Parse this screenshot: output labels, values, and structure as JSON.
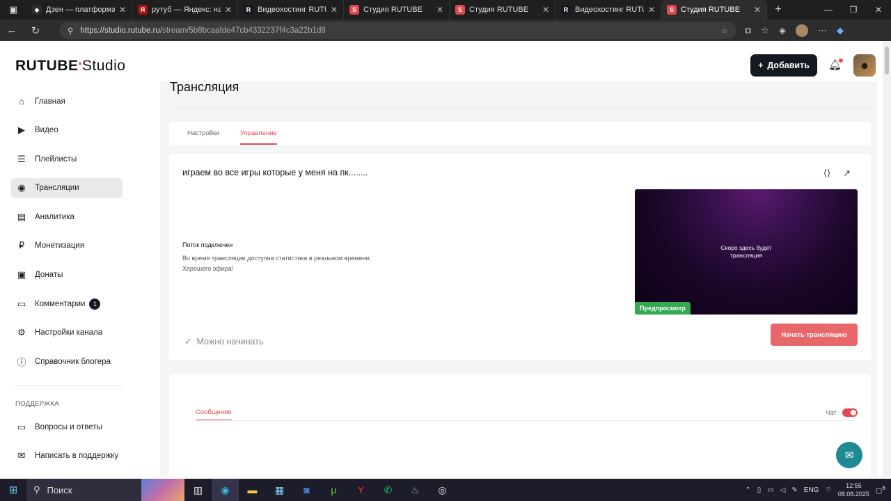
{
  "browser": {
    "tabs": [
      {
        "title": "Дзен — платформа для",
        "fav_color": "#2b2b2b",
        "fav_glyph": "◆"
      },
      {
        "title": "рутуб — Яндекс: нашло",
        "fav_color": "#a11",
        "fav_glyph": "Я"
      },
      {
        "title": "Видеохостинг RUTUBE.",
        "fav_color": "#14191f",
        "fav_glyph": "R"
      },
      {
        "title": "Студия RUTUBE",
        "fav_color": "#e2484d",
        "fav_glyph": "S"
      },
      {
        "title": "Студия RUTUBE",
        "fav_color": "#e2484d",
        "fav_glyph": "S"
      },
      {
        "title": "Видеохостинг RUTUBE.",
        "fav_color": "#14191f",
        "fav_glyph": "R"
      },
      {
        "title": "Студия RUTUBE",
        "fav_color": "#e2484d",
        "fav_glyph": "S"
      }
    ],
    "url_host": "https://studio.rutube.ru",
    "url_path": "/stream/5b8bcaafde47cb4332237f4c3a22b1d8"
  },
  "header": {
    "logo_main": "RUTUBE",
    "logo_sub": "Studio",
    "add_label": "Добавить"
  },
  "sidebar": {
    "items": [
      {
        "label": "Главная",
        "icon": "home-icon"
      },
      {
        "label": "Видео",
        "icon": "video-icon"
      },
      {
        "label": "Плейлисты",
        "icon": "playlist-icon"
      },
      {
        "label": "Трансляции",
        "icon": "broadcast-icon",
        "active": true
      },
      {
        "label": "Аналитика",
        "icon": "analytics-icon"
      },
      {
        "label": "Монетизация",
        "icon": "ruble-icon"
      },
      {
        "label": "Донаты",
        "icon": "donate-icon"
      },
      {
        "label": "Комментарии",
        "icon": "comment-icon",
        "badge": "1"
      },
      {
        "label": "Настройки канала",
        "icon": "gear-icon"
      },
      {
        "label": "Справочник блогера",
        "icon": "info-icon"
      }
    ],
    "section_support": "ПОДДЕРЖКА",
    "support_items": [
      {
        "label": "Вопросы и ответы",
        "icon": "faq-icon"
      },
      {
        "label": "Написать в поддержку",
        "icon": "write-icon"
      }
    ]
  },
  "main": {
    "page_title": "Трансляция",
    "tabs": [
      "Настройки",
      "Управление"
    ],
    "active_tab": "Управление",
    "stream_title": "играем во все игры которые у меня на пк........",
    "status": "Поток подключен",
    "hint_line1": "Во время трансляции доступна статистика в реальном времени.",
    "hint_line2": "Хорошего эфира!",
    "preview_text": "Скоро здесь будет трансляция",
    "preview_badge": "Предпросмотр",
    "ready_text": "Можно начинать",
    "start_button": "Начать трансляцию",
    "messages_tab": "Сообщения",
    "chat_label": "Чат",
    "chat_enabled": true
  },
  "taskbar": {
    "search_placeholder": "Поиск",
    "lang": "ENG",
    "time": "12:55",
    "date": "08.08.2025",
    "notif_count": "6"
  }
}
